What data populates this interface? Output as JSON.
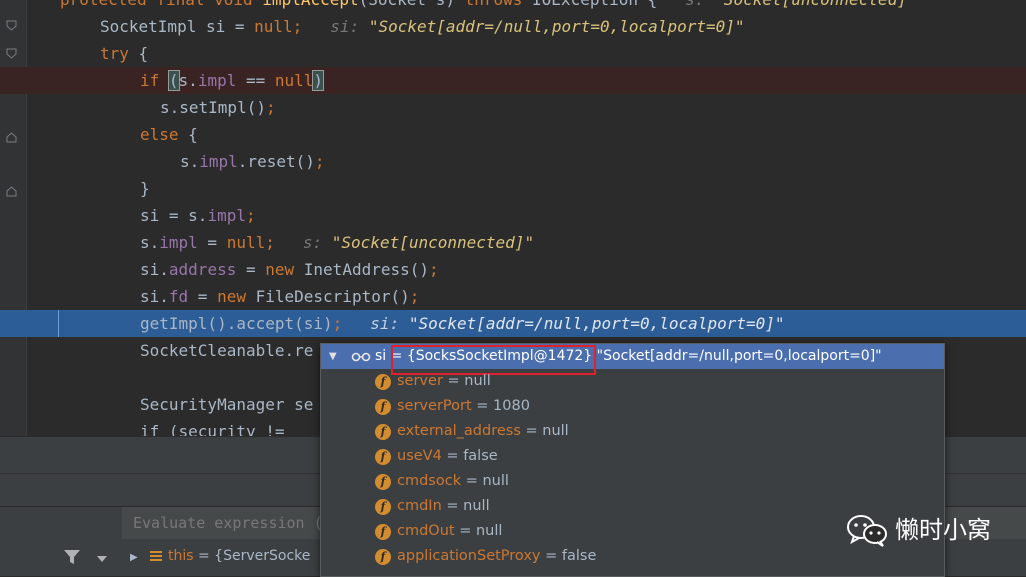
{
  "editor": {
    "lines": [
      {
        "id": "l0",
        "tokens": [
          {
            "t": "protected final void ",
            "c": "kw"
          },
          {
            "t": "implAccept",
            "c": "meth"
          },
          {
            "t": "(Socket s) ",
            "c": ""
          },
          {
            "t": "throws ",
            "c": "kw"
          },
          {
            "t": "IOException {",
            "c": ""
          }
        ],
        "hint": {
          "label": "s: ",
          "value": "\"Socket[unconnected]\""
        }
      },
      {
        "id": "l1",
        "tokens": [
          {
            "t": "SocketImpl si = ",
            "c": ""
          },
          {
            "t": "null",
            "c": "kw"
          },
          {
            "t": ";",
            "c": "kw"
          }
        ],
        "hint": {
          "label": "si: ",
          "value": "\"Socket[addr=/null,port=0,localport=0]\""
        }
      },
      {
        "id": "l2",
        "tokens": [
          {
            "t": "try ",
            "c": "kw"
          },
          {
            "t": "{",
            "c": ""
          }
        ]
      },
      {
        "id": "l3",
        "tokens": [
          {
            "t": "if ",
            "c": "kw"
          },
          {
            "t": "(",
            "c": "paren"
          },
          {
            "t": "s.",
            "c": ""
          },
          {
            "t": "impl",
            "c": "fld"
          },
          {
            "t": " == ",
            "c": ""
          },
          {
            "t": "null",
            "c": "kw"
          },
          {
            "t": ")",
            "c": "paren"
          }
        ]
      },
      {
        "id": "l4",
        "tokens": [
          {
            "t": "s.setImpl()",
            "c": ""
          },
          {
            "t": ";",
            "c": "kw"
          }
        ]
      },
      {
        "id": "l5",
        "tokens": [
          {
            "t": "else ",
            "c": "kw"
          },
          {
            "t": "{",
            "c": ""
          }
        ]
      },
      {
        "id": "l6",
        "tokens": [
          {
            "t": "s.",
            "c": ""
          },
          {
            "t": "impl",
            "c": "fld"
          },
          {
            "t": ".reset()",
            "c": ""
          },
          {
            "t": ";",
            "c": "kw"
          }
        ]
      },
      {
        "id": "l7",
        "tokens": [
          {
            "t": "}",
            "c": ""
          }
        ]
      },
      {
        "id": "l8",
        "tokens": [
          {
            "t": "si = s.",
            "c": ""
          },
          {
            "t": "impl",
            "c": "fld"
          },
          {
            "t": ";",
            "c": "kw"
          }
        ]
      },
      {
        "id": "l9",
        "tokens": [
          {
            "t": "s.",
            "c": ""
          },
          {
            "t": "impl",
            "c": "fld"
          },
          {
            "t": " = ",
            "c": ""
          },
          {
            "t": "null",
            "c": "kw"
          },
          {
            "t": ";",
            "c": "kw"
          }
        ],
        "hint": {
          "label": "s: ",
          "value": "\"Socket[unconnected]\""
        }
      },
      {
        "id": "l10",
        "tokens": [
          {
            "t": "si.",
            "c": ""
          },
          {
            "t": "address",
            "c": "fld"
          },
          {
            "t": " = ",
            "c": ""
          },
          {
            "t": "new ",
            "c": "kw"
          },
          {
            "t": "InetAddress()",
            "c": ""
          },
          {
            "t": ";",
            "c": "kw"
          }
        ]
      },
      {
        "id": "l11",
        "tokens": [
          {
            "t": "si.",
            "c": ""
          },
          {
            "t": "fd",
            "c": "fld"
          },
          {
            "t": " = ",
            "c": ""
          },
          {
            "t": "new ",
            "c": "kw"
          },
          {
            "t": "FileDescriptor()",
            "c": ""
          },
          {
            "t": ";",
            "c": "kw"
          }
        ]
      },
      {
        "id": "l12",
        "tokens": [
          {
            "t": "getImpl().accept(si)",
            "c": ""
          },
          {
            "t": ";",
            "c": "kw"
          }
        ],
        "hint": {
          "label": "si: ",
          "value": "\"Socket[addr=/null,port=0,localport=0]\""
        }
      },
      {
        "id": "l13",
        "tokens": [
          {
            "t": "SocketCleanable.re",
            "c": ""
          }
        ]
      },
      {
        "id": "l14",
        "tokens": []
      },
      {
        "id": "l15",
        "tokens": [
          {
            "t": "SecurityManager se",
            "c": ""
          }
        ]
      },
      {
        "id": "l16",
        "tokens": [
          {
            "t": "if (security != ",
            "c": ""
          }
        ]
      }
    ]
  },
  "popup": {
    "header": {
      "name": "si",
      "ref": " = {SocksSocketImpl@1472} ",
      "tostring": "\"Socket[addr=/null,port=0,localport=0]\""
    },
    "fields": [
      {
        "name": "server",
        "value": "null"
      },
      {
        "name": "serverPort",
        "value": "1080"
      },
      {
        "name": "external_address",
        "value": "null"
      },
      {
        "name": "useV4",
        "value": "false"
      },
      {
        "name": "cmdsock",
        "value": "null"
      },
      {
        "name": "cmdIn",
        "value": "null"
      },
      {
        "name": "cmdOut",
        "value": "null"
      },
      {
        "name": "applicationSetProxy",
        "value": "false"
      }
    ]
  },
  "debugger": {
    "evaluate_placeholder": "Evaluate expression (",
    "variable": {
      "name": "this",
      "value": " = {ServerSocke"
    }
  },
  "watermark": {
    "text": "懒时小窝"
  },
  "colors": {
    "keyword": "#cc7832",
    "field": "#9876aa",
    "method": "#ffc66d",
    "execution_line": "#2d5d96",
    "popup_header": "#4b6eaf",
    "highlight_box": "#e0202a"
  }
}
